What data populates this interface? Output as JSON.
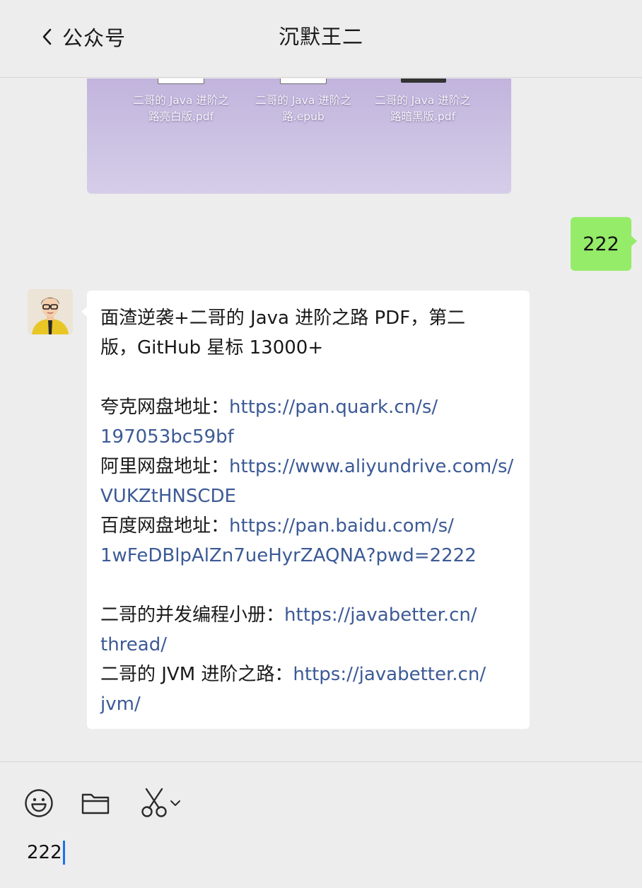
{
  "header": {
    "back_label": "公众号",
    "title": "沉默王二"
  },
  "image_card": {
    "files": [
      {
        "line1": "二哥的 Java 进阶之",
        "line2": "路亮白版.pdf",
        "icon_color": "#ffffff"
      },
      {
        "line1": "二哥的 Java 进阶之",
        "line2": "路.epub",
        "icon_color": "#ffffff"
      },
      {
        "line1": "二哥的 Java 进阶之",
        "line2": "路暗黑版.pdf",
        "icon_color": "#333333"
      }
    ]
  },
  "sent_message": {
    "text": "222"
  },
  "received_message": {
    "intro_line1": "面渣逆袭+二哥的 Java 进阶之路 PDF，第二",
    "intro_line2": "版，GitHub 星标 13000+",
    "quark_label": "夸克网盘地址：",
    "quark_url_1": "https://pan.quark.cn/s/",
    "quark_url_2": "197053bc59bf",
    "aliyun_label": "阿里网盘地址：",
    "aliyun_url_1": "https://www.aliyundrive.com/s/",
    "aliyun_url_2": "VUKZtHNSCDE",
    "baidu_label": "百度网盘地址：",
    "baidu_url_1": "https://pan.baidu.com/s/",
    "baidu_url_2": "1wFeDBlpAlZn7ueHyrZAQNA?pwd=2222",
    "thread_label": "二哥的并发编程小册：",
    "thread_url_1": "https://javabetter.cn/",
    "thread_url_2": "thread/",
    "jvm_label": "二哥的 JVM 进阶之路：",
    "jvm_url_1": "https://javabetter.cn/",
    "jvm_url_2": "jvm/"
  },
  "composer": {
    "input_value": "222",
    "tools": [
      "emoji-icon",
      "folder-icon",
      "scissors-icon",
      "chevron-down-icon"
    ]
  },
  "colors": {
    "background": "#ededed",
    "sent_bubble": "#95ec69",
    "received_bubble": "#ffffff",
    "link": "#3c5a95",
    "caret": "#1a73e8"
  }
}
